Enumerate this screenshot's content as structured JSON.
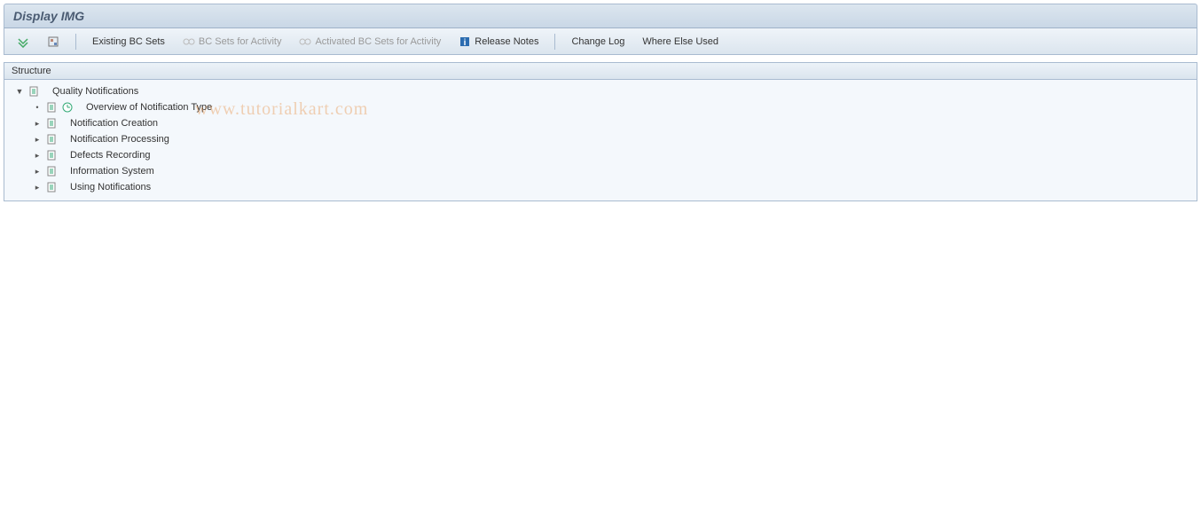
{
  "header": {
    "title": "Display IMG"
  },
  "toolbar": {
    "existing_bc_sets": "Existing BC Sets",
    "bc_sets_for_activity": "BC Sets for Activity",
    "activated_bc_sets_for_activity": "Activated BC Sets for Activity",
    "release_notes": "Release Notes",
    "change_log": "Change Log",
    "where_else_used": "Where Else Used"
  },
  "panel": {
    "header": "Structure"
  },
  "tree": {
    "root": {
      "expander": "▼",
      "label": "Quality Notifications"
    },
    "children": [
      {
        "expander": "•",
        "label": "Overview of Notification Type",
        "has_clock": true
      },
      {
        "expander": "▸",
        "label": "Notification Creation",
        "has_clock": false
      },
      {
        "expander": "▸",
        "label": "Notification Processing",
        "has_clock": false
      },
      {
        "expander": "▸",
        "label": "Defects Recording",
        "has_clock": false
      },
      {
        "expander": "▸",
        "label": "Information System",
        "has_clock": false
      },
      {
        "expander": "▸",
        "label": "Using Notifications",
        "has_clock": false
      }
    ]
  },
  "watermark": "www.tutorialkart.com"
}
